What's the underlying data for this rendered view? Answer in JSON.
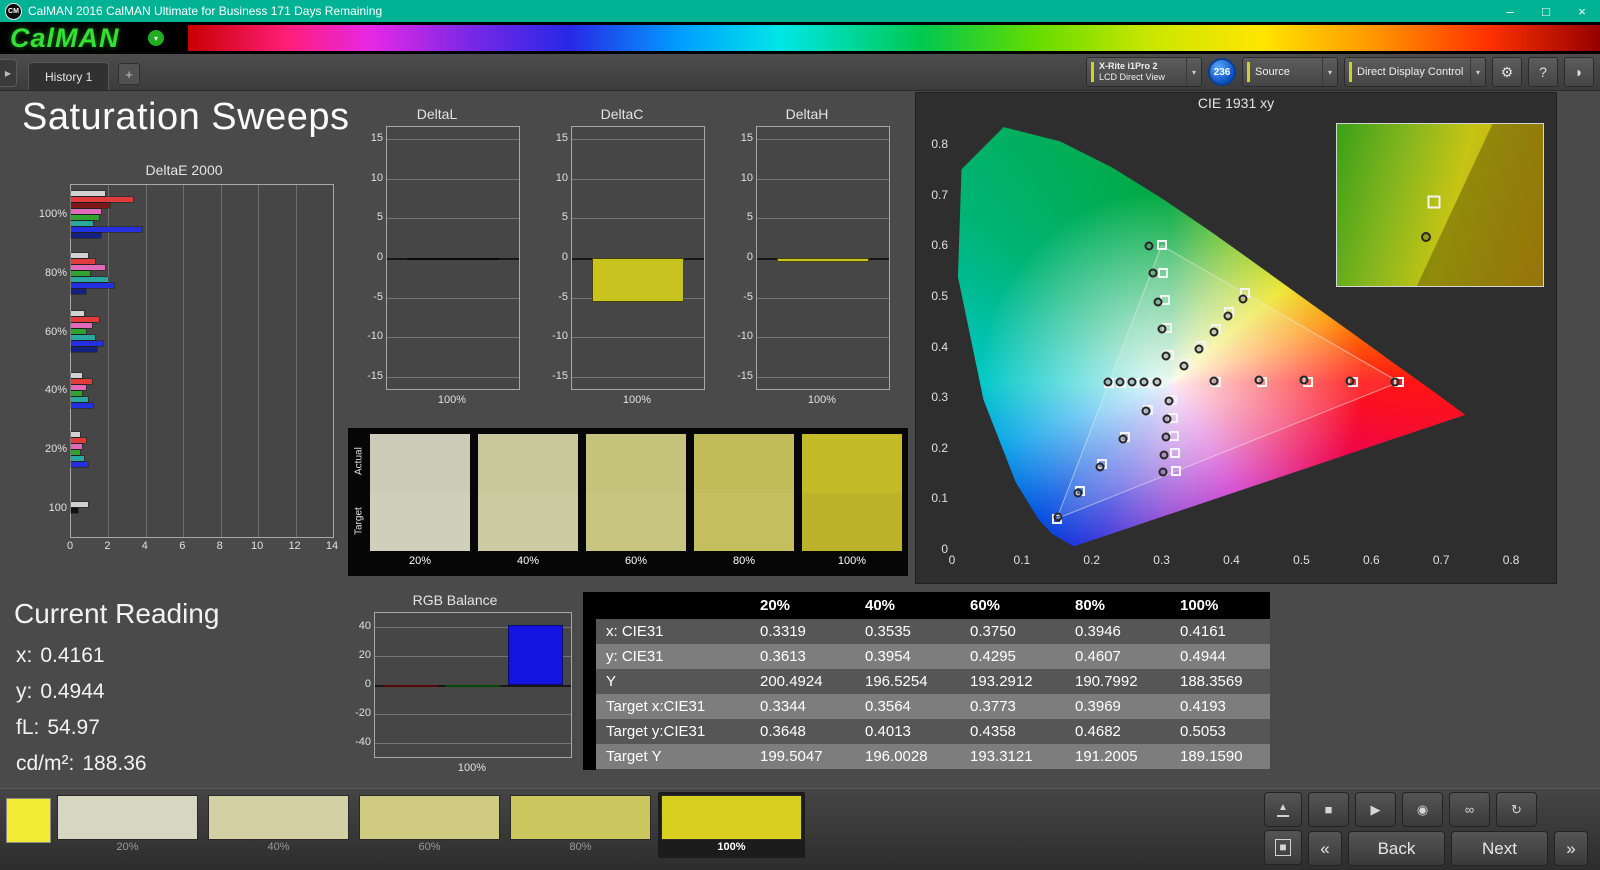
{
  "window": {
    "title": "CalMAN 2016 CalMAN Ultimate for Business 171 Days Remaining",
    "app_badge": "CM",
    "minimize": "–",
    "maximize": "□",
    "close": "×"
  },
  "brand": {
    "logo": "CalMAN",
    "menu_arrow": "▾"
  },
  "tabs": {
    "collapse_arrow": "▶",
    "history_tab": "History 1",
    "add_tab": "+"
  },
  "toolbar": {
    "meter_line1": "X-Rite i1Pro 2",
    "meter_line2": "LCD Direct View",
    "meter_badge": "236",
    "source_label": "Source",
    "control_label": "Direct Display Control",
    "gear_icon": "⚙",
    "help_icon": "?",
    "session_icon": "◗",
    "dropdown_arrow": "▾"
  },
  "page": {
    "title": "Saturation Sweeps",
    "current_reading": {
      "heading": "Current Reading",
      "x_label": "x:",
      "x_value": "0.4161",
      "y_label": "y:",
      "y_value": "0.4944",
      "fl_label": "fL:",
      "fl_value": "54.97",
      "cd_label": "cd/m²:",
      "cd_value": "188.36"
    }
  },
  "chart_data": {
    "deltae": {
      "type": "bar",
      "orientation": "horizontal",
      "title": "DeltaE 2000",
      "xlim": [
        0,
        14
      ],
      "xticks": [
        "0",
        "2",
        "4",
        "6",
        "8",
        "10",
        "12",
        "14"
      ],
      "groups": [
        {
          "label": "100%",
          "bars": [
            {
              "color": "#d2d2d2",
              "value": 1.8
            },
            {
              "color": "#e03c3c",
              "value": 3.3
            },
            {
              "color": "#7e1818",
              "value": 2.1
            },
            {
              "color": "#e06ab8",
              "value": 1.6
            },
            {
              "color": "#2fa32f",
              "value": 1.5
            },
            {
              "color": "#2aa8a0",
              "value": 1.2
            },
            {
              "color": "#2430e0",
              "value": 3.8
            },
            {
              "color": "#16207e",
              "value": 1.6
            }
          ]
        },
        {
          "label": "80%",
          "bars": [
            {
              "color": "#d2d2d2",
              "value": 0.9
            },
            {
              "color": "#e03c3c",
              "value": 1.3
            },
            {
              "color": "#e06ab8",
              "value": 1.8
            },
            {
              "color": "#2fa32f",
              "value": 1.0
            },
            {
              "color": "#2aa8a0",
              "value": 2.0
            },
            {
              "color": "#2430e0",
              "value": 2.3
            },
            {
              "color": "#16207e",
              "value": 0.8
            }
          ]
        },
        {
          "label": "60%",
          "bars": [
            {
              "color": "#d2d2d2",
              "value": 0.7
            },
            {
              "color": "#e03c3c",
              "value": 1.5
            },
            {
              "color": "#e06ab8",
              "value": 1.1
            },
            {
              "color": "#2fa32f",
              "value": 0.8
            },
            {
              "color": "#2aa8a0",
              "value": 1.3
            },
            {
              "color": "#2430e0",
              "value": 1.7
            },
            {
              "color": "#16207e",
              "value": 1.4
            }
          ]
        },
        {
          "label": "40%",
          "bars": [
            {
              "color": "#d2d2d2",
              "value": 0.6
            },
            {
              "color": "#e03c3c",
              "value": 1.1
            },
            {
              "color": "#e06ab8",
              "value": 0.8
            },
            {
              "color": "#2fa32f",
              "value": 0.6
            },
            {
              "color": "#2aa8a0",
              "value": 0.9
            },
            {
              "color": "#2430e0",
              "value": 1.2
            }
          ]
        },
        {
          "label": "20%",
          "bars": [
            {
              "color": "#d2d2d2",
              "value": 0.5
            },
            {
              "color": "#e03c3c",
              "value": 0.8
            },
            {
              "color": "#e06ab8",
              "value": 0.6
            },
            {
              "color": "#2fa32f",
              "value": 0.5
            },
            {
              "color": "#2aa8a0",
              "value": 0.7
            },
            {
              "color": "#2430e0",
              "value": 0.9
            }
          ]
        },
        {
          "label": "100",
          "bars": [
            {
              "color": "#d2d2d2",
              "value": 0.9
            },
            {
              "color": "#111111",
              "value": 0.4
            }
          ]
        }
      ]
    },
    "deltaL": {
      "type": "bar",
      "title": "DeltaL",
      "ylim": [
        -15,
        15
      ],
      "yticks": [
        15,
        10,
        5,
        0,
        -5,
        -10,
        -15
      ],
      "xlabel": "100%",
      "value": -0.3,
      "color": "#151515"
    },
    "deltaC": {
      "type": "bar",
      "title": "DeltaC",
      "ylim": [
        -15,
        15
      ],
      "yticks": [
        15,
        10,
        5,
        0,
        -5,
        -10,
        -15
      ],
      "xlabel": "100%",
      "value": -5.5,
      "color": "#c9c31f"
    },
    "deltaH": {
      "type": "bar",
      "title": "DeltaH",
      "ylim": [
        -15,
        15
      ],
      "yticks": [
        15,
        10,
        5,
        0,
        -5,
        -10,
        -15
      ],
      "xlabel": "100%",
      "value": -0.5,
      "color": "#c9c31f"
    },
    "rgb": {
      "type": "bar",
      "title": "RGB Balance",
      "ylim": [
        -50,
        50
      ],
      "yticks": [
        40,
        20,
        0,
        -20,
        -40
      ],
      "xlabel": "100%",
      "series": [
        {
          "name": "Red",
          "color": "#b01010",
          "value": -1.2
        },
        {
          "name": "Green",
          "color": "#0e8f0e",
          "value": -0.6
        },
        {
          "name": "Blue",
          "color": "#1414e0",
          "value": 41.5
        }
      ]
    },
    "cie": {
      "type": "scatter",
      "title": "CIE 1931 xy",
      "xlim": [
        0,
        0.85
      ],
      "ylim": [
        0,
        0.85
      ],
      "xticks": [
        "0",
        "0.1",
        "0.2",
        "0.3",
        "0.4",
        "0.5",
        "0.6",
        "0.7",
        "0.8"
      ],
      "yticks": [
        "0",
        "0.1",
        "0.2",
        "0.3",
        "0.4",
        "0.5",
        "0.6",
        "0.7",
        "0.8"
      ],
      "white_point": [
        0.3127,
        0.329
      ],
      "gamut_triangle": [
        [
          0.64,
          0.33
        ],
        [
          0.3,
          0.6
        ],
        [
          0.15,
          0.06
        ]
      ],
      "targets": [
        [
          0.3344,
          0.3648
        ],
        [
          0.3564,
          0.4013
        ],
        [
          0.3773,
          0.4358
        ],
        [
          0.3969,
          0.4682
        ],
        [
          0.4193,
          0.5053
        ],
        [
          0.3781,
          0.3294
        ],
        [
          0.4436,
          0.3295
        ],
        [
          0.509,
          0.3297
        ],
        [
          0.5745,
          0.3298
        ],
        [
          0.64,
          0.33
        ],
        [
          0.3102,
          0.3832
        ],
        [
          0.3076,
          0.4374
        ],
        [
          0.3051,
          0.4916
        ],
        [
          0.3025,
          0.5458
        ],
        [
          0.3,
          0.6
        ],
        [
          0.2951,
          0.3289
        ],
        [
          0.2775,
          0.3288
        ],
        [
          0.2599,
          0.3288
        ],
        [
          0.2422,
          0.3287
        ],
        [
          0.2246,
          0.3287
        ],
        [
          0.3143,
          0.294
        ],
        [
          0.316,
          0.259
        ],
        [
          0.3176,
          0.2241
        ],
        [
          0.3193,
          0.1891
        ],
        [
          0.3209,
          0.1542
        ],
        [
          0.2801,
          0.2752
        ],
        [
          0.2476,
          0.2214
        ],
        [
          0.215,
          0.1676
        ],
        [
          0.1825,
          0.1138
        ],
        [
          0.15,
          0.06
        ]
      ],
      "measured": [
        [
          0.3319,
          0.3613
        ],
        [
          0.3535,
          0.3954
        ],
        [
          0.375,
          0.4295
        ],
        [
          0.3946,
          0.4607
        ],
        [
          0.4161,
          0.4944
        ],
        [
          0.3752,
          0.3315
        ],
        [
          0.439,
          0.3332
        ],
        [
          0.5035,
          0.3334
        ],
        [
          0.569,
          0.3324
        ],
        [
          0.634,
          0.331
        ],
        [
          0.306,
          0.381
        ],
        [
          0.3,
          0.435
        ],
        [
          0.295,
          0.488
        ],
        [
          0.287,
          0.545
        ],
        [
          0.282,
          0.598
        ],
        [
          0.293,
          0.3302
        ],
        [
          0.275,
          0.3303
        ],
        [
          0.257,
          0.3304
        ],
        [
          0.24,
          0.3304
        ],
        [
          0.223,
          0.3305
        ],
        [
          0.31,
          0.292
        ],
        [
          0.308,
          0.256
        ],
        [
          0.306,
          0.221
        ],
        [
          0.304,
          0.186
        ],
        [
          0.302,
          0.152
        ],
        [
          0.278,
          0.272
        ],
        [
          0.245,
          0.218
        ],
        [
          0.212,
          0.163
        ],
        [
          0.18,
          0.11
        ],
        [
          0.152,
          0.063
        ]
      ],
      "inset": {
        "square": [
          0.47,
          0.48
        ],
        "circle": [
          0.43,
          0.7
        ]
      }
    },
    "table": {
      "type": "table",
      "columns": [
        "",
        "20%",
        "40%",
        "60%",
        "80%",
        "100%"
      ],
      "rows": [
        [
          "x: CIE31",
          "0.3319",
          "0.3535",
          "0.3750",
          "0.3946",
          "0.4161"
        ],
        [
          "y: CIE31",
          "0.3613",
          "0.3954",
          "0.4295",
          "0.4607",
          "0.4944"
        ],
        [
          "Y",
          "200.4924",
          "196.5254",
          "193.2912",
          "190.7992",
          "188.3569"
        ],
        [
          "Target x:CIE31",
          "0.3344",
          "0.3564",
          "0.3773",
          "0.3969",
          "0.4193"
        ],
        [
          "Target y:CIE31",
          "0.3648",
          "0.4013",
          "0.4358",
          "0.4682",
          "0.5053"
        ],
        [
          "Target Y",
          "199.5047",
          "196.0028",
          "193.3121",
          "191.2005",
          "189.1590"
        ]
      ]
    }
  },
  "swatch_strip": {
    "actual_label": "Actual",
    "target_label": "Target",
    "items": [
      {
        "label": "20%",
        "actual": "#cbccb8",
        "target": "#cfd0bc"
      },
      {
        "label": "40%",
        "actual": "#c9c79c",
        "target": "#cccaa0"
      },
      {
        "label": "60%",
        "actual": "#c5c27c",
        "target": "#c8c580"
      },
      {
        "label": "80%",
        "actual": "#c1bb5a",
        "target": "#c4be5e"
      },
      {
        "label": "100%",
        "actual": "#c3ba28",
        "target": "#bcb32a"
      }
    ]
  },
  "bottom_bar": {
    "current_color": "#f2ec35",
    "swatches": [
      {
        "label": "20%",
        "color": "#d6d6c1",
        "selected": false
      },
      {
        "label": "40%",
        "color": "#d3d0a4",
        "selected": false
      },
      {
        "label": "60%",
        "color": "#cfcb82",
        "selected": false
      },
      {
        "label": "80%",
        "color": "#cbc65e",
        "selected": false
      },
      {
        "label": "100%",
        "color": "#d8cf20",
        "selected": true
      }
    ],
    "transport": {
      "eject_icon": "▲",
      "layout_icon": "■",
      "stop_icon": "■",
      "play_icon": "▶",
      "record_icon": "◉",
      "loop_icon": "∞",
      "refresh_icon": "↻",
      "prev_icon": "«",
      "back_label": "Back",
      "next_label": "Next",
      "next_icon": "»"
    }
  }
}
